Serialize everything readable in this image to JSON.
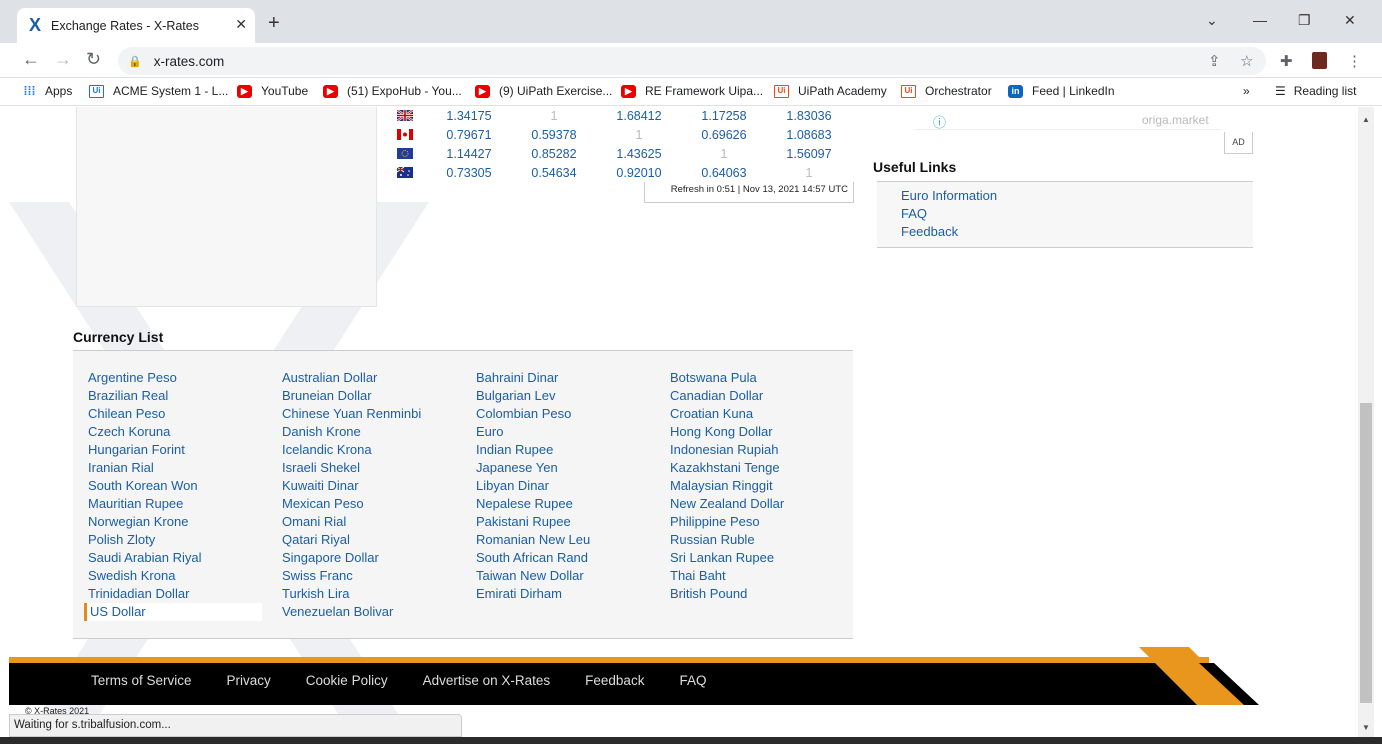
{
  "browser": {
    "tab_title": "Exchange Rates - X-Rates",
    "url": "x-rates.com",
    "bookmarks": [
      {
        "label": "Apps",
        "icon": "apps-grid"
      },
      {
        "label": "ACME System 1 - L...",
        "icon": "uipath-blue"
      },
      {
        "label": "YouTube",
        "icon": "youtube"
      },
      {
        "label": "(51) ExpoHub - You...",
        "icon": "youtube"
      },
      {
        "label": "(9) UiPath Exercise...",
        "icon": "youtube"
      },
      {
        "label": "RE Framework Uipa...",
        "icon": "youtube"
      },
      {
        "label": "UiPath Academy",
        "icon": "uipath"
      },
      {
        "label": "Orchestrator",
        "icon": "uipath"
      },
      {
        "label": "Feed | LinkedIn",
        "icon": "linkedin"
      }
    ],
    "reading_list": "Reading list",
    "overflow": "»"
  },
  "rates": [
    {
      "flag": "gb",
      "values": [
        "1.34175",
        "1",
        "1.68412",
        "1.17258",
        "1.83036"
      ]
    },
    {
      "flag": "ca",
      "values": [
        "0.79671",
        "0.59378",
        "1",
        "0.69626",
        "1.08683"
      ]
    },
    {
      "flag": "eu",
      "values": [
        "1.14427",
        "0.85282",
        "1.43625",
        "1",
        "1.56097"
      ]
    },
    {
      "flag": "au",
      "values": [
        "0.73305",
        "0.54634",
        "0.92010",
        "0.64063",
        "1"
      ]
    }
  ],
  "refresh": "Refresh in 0:51 | Nov 13, 2021 14:57 UTC",
  "ad": {
    "info": "ⓘ",
    "brand": "origa.market",
    "tag": "AD"
  },
  "useful": {
    "title": "Useful Links",
    "links": [
      "Euro Information",
      "FAQ",
      "Feedback"
    ]
  },
  "currency": {
    "title": "Currency List",
    "columns": [
      [
        "Argentine Peso",
        "Brazilian Real",
        "Chilean Peso",
        "Czech Koruna",
        "Hungarian Forint",
        "Iranian Rial",
        "South Korean Won",
        "Mauritian Rupee",
        "Norwegian Krone",
        "Polish Zloty",
        "Saudi Arabian Riyal",
        "Swedish Krona",
        "Trinidadian Dollar",
        "US Dollar"
      ],
      [
        "Australian Dollar",
        "Bruneian Dollar",
        "Chinese Yuan Renminbi",
        "Danish Krone",
        "Icelandic Krona",
        "Israeli Shekel",
        "Kuwaiti Dinar",
        "Mexican Peso",
        "Omani Rial",
        "Qatari Riyal",
        "Singapore Dollar",
        "Swiss Franc",
        "Turkish Lira",
        "Venezuelan Bolivar"
      ],
      [
        "Bahraini Dinar",
        "Bulgarian Lev",
        "Colombian Peso",
        "Euro",
        "Indian Rupee",
        "Japanese Yen",
        "Libyan Dinar",
        "Nepalese Rupee",
        "Pakistani Rupee",
        "Romanian New Leu",
        "South African Rand",
        "Taiwan New Dollar",
        "Emirati Dirham"
      ],
      [
        "Botswana Pula",
        "Canadian Dollar",
        "Croatian Kuna",
        "Hong Kong Dollar",
        "Indonesian Rupiah",
        "Kazakhstani Tenge",
        "Malaysian Ringgit",
        "New Zealand Dollar",
        "Philippine Peso",
        "Russian Ruble",
        "Sri Lankan Rupee",
        "Thai Baht",
        "British Pound"
      ]
    ],
    "selected": "US Dollar"
  },
  "footer": {
    "links": [
      "Terms of Service",
      "Privacy",
      "Cookie Policy",
      "Advertise on X-Rates",
      "Feedback",
      "FAQ"
    ],
    "copyright": "© X-Rates 2021"
  },
  "status": "Waiting for s.tribalfusion.com...",
  "colors": {
    "link": "#1a5ea8",
    "accent": "#e8961e",
    "footer_bg": "#000000"
  }
}
